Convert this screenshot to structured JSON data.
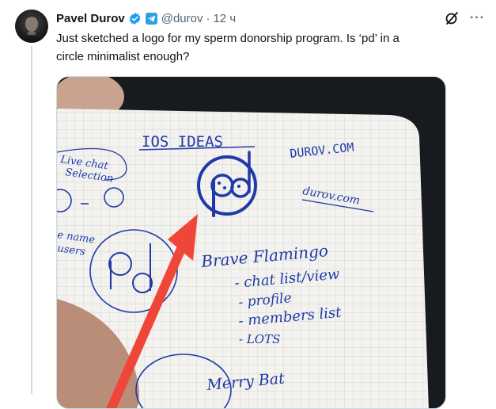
{
  "author": {
    "name": "Pavel Durov",
    "handle": "@durov",
    "separator": "·",
    "time": "12 ч"
  },
  "icons": {
    "verified": "verified-badge-icon",
    "telegram": "telegram-icon",
    "grok": "grok-icon",
    "more": "more-icon"
  },
  "more_label": "···",
  "tweet": {
    "text": "Just sketched a logo for my sperm donorship program. Is ‘pd’ in a circle minimalist enough?"
  },
  "sketch": {
    "heading": "IOS IDEAS",
    "domain_1": "DUROV.COM",
    "domain_2": "durov.com",
    "left_1": "Live chat",
    "left_2": "Selection",
    "left_3": "e name",
    "left_4": "users",
    "item_title": "Brave Flamingo",
    "item_1": "- chat list/view",
    "item_2": "- profile",
    "item_3": "- members list",
    "item_4": "- LOTS",
    "bottom": "Merry Bat"
  },
  "colors": {
    "accent": "#1d9bf0",
    "ink": "#1f3aa8",
    "arrow": "#f0463a"
  }
}
